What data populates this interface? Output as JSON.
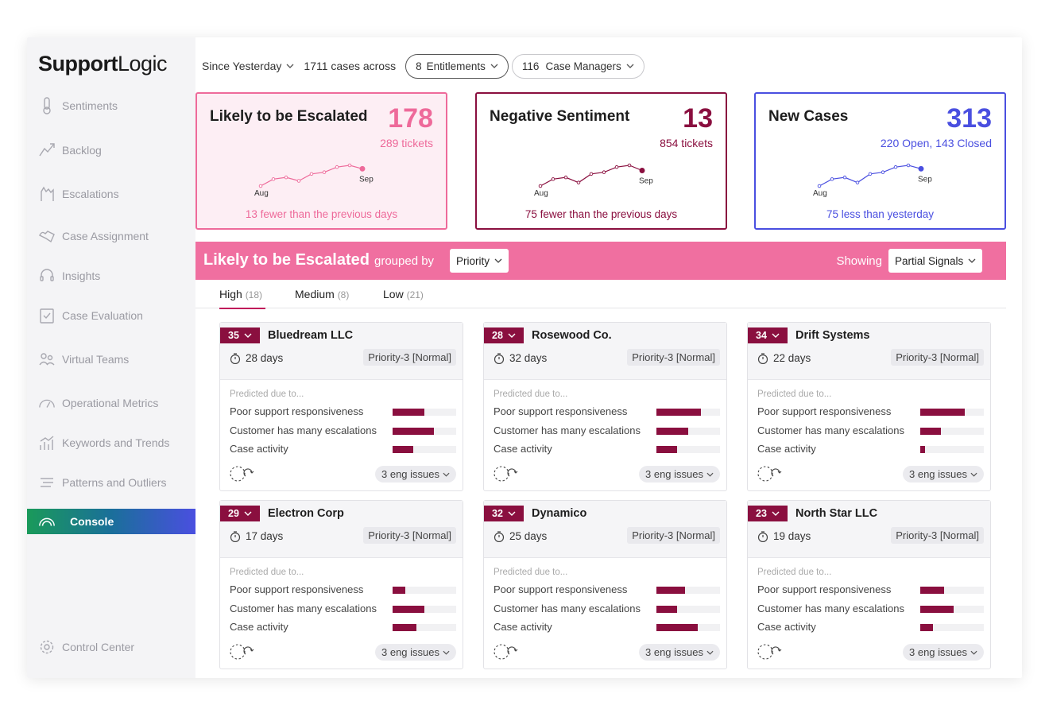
{
  "app": {
    "logo_strong": "Support",
    "logo_light": "Logic"
  },
  "sidebar": {
    "items": [
      {
        "label": "Sentiments",
        "icon": "thermometer-icon"
      },
      {
        "label": "Backlog",
        "icon": "trend-icon"
      },
      {
        "label": "Escalations",
        "icon": "escalation-icon"
      },
      {
        "label": "Case Assignment",
        "icon": "assignment-icon"
      },
      {
        "label": "Insights",
        "icon": "headset-icon"
      },
      {
        "label": "Case Evaluation",
        "icon": "clipboard-icon"
      },
      {
        "label": "Virtual Teams",
        "icon": "team-icon"
      },
      {
        "label": "Operational Metrics",
        "icon": "gauge-icon"
      },
      {
        "label": "Keywords and Trends",
        "icon": "chart-icon"
      },
      {
        "label": "Patterns and Outliers",
        "icon": "lines-icon"
      },
      {
        "label": "Console",
        "icon": "gauge-icon"
      }
    ],
    "active": "Console",
    "footer": {
      "label": "Control Center",
      "icon": "gear-icon"
    }
  },
  "topbar": {
    "period": "Since Yesterday",
    "cases_text": "1711 cases across",
    "entitlements_count": "8",
    "entitlements_label": "Entitlements",
    "managers_count": "116",
    "managers_label": "Case Managers"
  },
  "kpis": [
    {
      "title": "Likely to be Escalated",
      "value": "178",
      "sub": "289 tickets",
      "footer": "13 fewer than the previous days",
      "start_label": "Aug",
      "end_label": "Sep",
      "trend": [
        2,
        6,
        7,
        5,
        9,
        10,
        13,
        14,
        12
      ],
      "color": "#ee6a9a",
      "sub_color": "#ee6a9a",
      "border": "#ee6a9a",
      "bg": "#fdeef4"
    },
    {
      "title": "Negative Sentiment",
      "value": "13",
      "sub": "854 tickets",
      "footer": "75 fewer than the previous days",
      "start_label": "Aug",
      "end_label": "Sep",
      "trend": [
        2,
        6,
        7,
        4,
        9,
        10,
        13,
        14,
        11
      ],
      "color": "#8a0f3f",
      "sub_color": "#8a0f3f",
      "border": "#8a0f3f",
      "bg": "#ffffff"
    },
    {
      "title": "New Cases",
      "value": "313",
      "sub": "220 Open, 143 Closed",
      "footer": "75 less than yesterday",
      "start_label": "Aug",
      "end_label": "Sep",
      "trend": [
        2,
        6,
        7,
        4,
        9,
        10,
        13,
        14,
        12
      ],
      "color": "#4a4fe0",
      "sub_color": "#4a4fe0",
      "border": "#4a4fe0",
      "bg": "#ffffff"
    }
  ],
  "band": {
    "title": "Likely to be Escalated",
    "grouped_by": "grouped by",
    "group_value": "Priority",
    "showing_label": "Showing",
    "showing_value": "Partial Signals"
  },
  "tabs": [
    {
      "label": "High",
      "count": "(18)"
    },
    {
      "label": "Medium",
      "count": "(8)"
    },
    {
      "label": "Low",
      "count": "(21)"
    }
  ],
  "predicted_label": "Predicted due to...",
  "reasons": [
    "Poor support responsiveness",
    "Customer has many escalations",
    "Case activity"
  ],
  "cards": [
    {
      "score": "35",
      "company": "Bluedream LLC",
      "days": "28 days",
      "priority": "Priority-3 [Normal]",
      "bars": [
        0.5,
        0.65,
        0.32
      ],
      "eng": "3 eng issues"
    },
    {
      "score": "28",
      "company": "Rosewood Co.",
      "days": "32 days",
      "priority": "Priority-3 [Normal]",
      "bars": [
        0.7,
        0.5,
        0.32
      ],
      "eng": "3 eng issues"
    },
    {
      "score": "34",
      "company": "Drift Systems",
      "days": "22 days",
      "priority": "Priority-3 [Normal]",
      "bars": [
        0.7,
        0.32,
        0.08
      ],
      "eng": "3 eng issues"
    },
    {
      "score": "29",
      "company": "Electron Corp",
      "days": "17 days",
      "priority": "Priority-3 [Normal]",
      "bars": [
        0.2,
        0.5,
        0.38
      ],
      "eng": "3 eng issues"
    },
    {
      "score": "32",
      "company": "Dynamico",
      "days": "25 days",
      "priority": "Priority-3 [Normal]",
      "bars": [
        0.45,
        0.32,
        0.65
      ],
      "eng": "3 eng issues"
    },
    {
      "score": "23",
      "company": "North Star LLC",
      "days": "19 days",
      "priority": "Priority-3 [Normal]",
      "bars": [
        0.38,
        0.52,
        0.2
      ],
      "eng": "3 eng issues"
    }
  ]
}
